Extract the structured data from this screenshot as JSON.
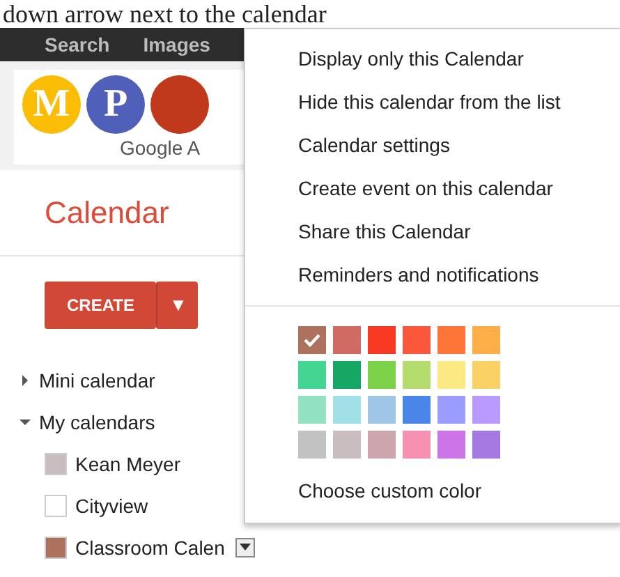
{
  "caption": "down arrow next to the calendar",
  "top_bar": {
    "links": [
      "Search",
      "Images"
    ]
  },
  "logos": [
    {
      "letter": "M",
      "color": "#fbbc05"
    },
    {
      "letter": "P",
      "color": "#5060b8"
    },
    {
      "color": "#c0391b"
    }
  ],
  "logo_text": "Google A",
  "app_title": "Calendar",
  "create_button": {
    "label": "CREATE",
    "caret": "▼"
  },
  "sections": [
    {
      "label": "Mini calendar",
      "expanded": false
    },
    {
      "label": "My calendars",
      "expanded": true
    }
  ],
  "calendars": [
    {
      "name": "Kean Meyer",
      "color": "#cabdbf",
      "menu_open": false
    },
    {
      "name": "Cityview",
      "color": "#ffffff",
      "menu_open": false
    },
    {
      "name": "Classroom Calen",
      "color": "#ac725e",
      "menu_open": true
    }
  ],
  "menu": {
    "items": [
      "Display only this Calendar",
      "Hide this calendar from the list",
      "Calendar settings",
      "Create event on this calendar",
      "Share this Calendar",
      "Reminders and notifications"
    ],
    "swatches": [
      {
        "color": "#ac725e",
        "selected": true
      },
      {
        "color": "#d06b64",
        "selected": false
      },
      {
        "color": "#f83a22",
        "selected": false
      },
      {
        "color": "#fa573c",
        "selected": false
      },
      {
        "color": "#ff7537",
        "selected": false
      },
      {
        "color": "#ffad46",
        "selected": false
      },
      {
        "color": "#42d692",
        "selected": false
      },
      {
        "color": "#16a765",
        "selected": false
      },
      {
        "color": "#7bd148",
        "selected": false
      },
      {
        "color": "#b3dc6c",
        "selected": false
      },
      {
        "color": "#fbe983",
        "selected": false
      },
      {
        "color": "#fad165",
        "selected": false
      },
      {
        "color": "#92e1c0",
        "selected": false
      },
      {
        "color": "#9fe1e7",
        "selected": false
      },
      {
        "color": "#9fc6e7",
        "selected": false
      },
      {
        "color": "#4986e7",
        "selected": false
      },
      {
        "color": "#9a9cff",
        "selected": false
      },
      {
        "color": "#b99aff",
        "selected": false
      },
      {
        "color": "#c2c2c2",
        "selected": false
      },
      {
        "color": "#cabdbf",
        "selected": false
      },
      {
        "color": "#cca6ac",
        "selected": false
      },
      {
        "color": "#f691b2",
        "selected": false
      },
      {
        "color": "#cd74e6",
        "selected": false
      },
      {
        "color": "#a47ae2",
        "selected": false
      }
    ],
    "custom_color": "Choose custom color"
  }
}
